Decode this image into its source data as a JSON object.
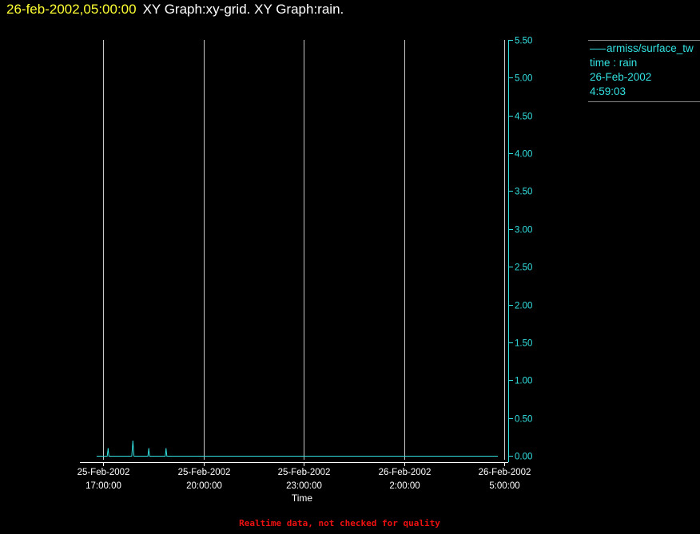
{
  "header": {
    "timestamp": "26-feb-2002,05:00:00",
    "graph_title": "XY Graph:xy-grid.  XY Graph:rain."
  },
  "legend": {
    "series_name": "armiss/surface_tw",
    "line2": "time : rain",
    "line3": "26-Feb-2002",
    "line4": "4:59:03"
  },
  "footer": {
    "note": "Realtime data, not checked for quality"
  },
  "colors": {
    "background": "#000000",
    "series": "#33e0e0",
    "grid": "#c8c8c8",
    "axis": "#ffffff",
    "timestamp": "#ffff33",
    "note": "#ee1111"
  },
  "chart_data": {
    "type": "line",
    "xlabel": "Time",
    "ylabel": "",
    "x_range": [
      "2002-02-25 16:48:00",
      "2002-02-26 04:48:00"
    ],
    "ylim": [
      0.0,
      5.5
    ],
    "y_ticks": [
      0.0,
      0.5,
      1.0,
      1.5,
      2.0,
      2.5,
      3.0,
      3.5,
      4.0,
      4.5,
      5.0,
      5.5
    ],
    "y_tick_labels": [
      "0.00",
      "0.50",
      "1.00",
      "1.50",
      "2.00",
      "2.50",
      "3.00",
      "3.50",
      "4.00",
      "4.50",
      "5.00",
      "5.50"
    ],
    "x_ticks": [
      {
        "time": "2002-02-25 17:00:00",
        "line1": "25-Feb-2002",
        "line2": "17:00:00"
      },
      {
        "time": "2002-02-25 20:00:00",
        "line1": "25-Feb-2002",
        "line2": "20:00:00"
      },
      {
        "time": "2002-02-25 23:00:00",
        "line1": "25-Feb-2002",
        "line2": "23:00:00"
      },
      {
        "time": "2002-02-26 02:00:00",
        "line1": "26-Feb-2002",
        "line2": "2:00:00"
      },
      {
        "time": "2002-02-26 05:00:00",
        "line1": "26-Feb-2002",
        "line2": "5:00:00"
      }
    ],
    "grid": "vertical",
    "y_axis_side": "right",
    "series": [
      {
        "name": "armiss/surface_tw",
        "points": [
          [
            "2002-02-25 16:48:00",
            0.0
          ],
          [
            "2002-02-25 17:07:00",
            0.0
          ],
          [
            "2002-02-25 17:08:30",
            0.1
          ],
          [
            "2002-02-25 17:10:00",
            0.0
          ],
          [
            "2002-02-25 17:51:00",
            0.0
          ],
          [
            "2002-02-25 17:53:00",
            0.2
          ],
          [
            "2002-02-25 17:55:00",
            0.0
          ],
          [
            "2002-02-25 18:20:00",
            0.0
          ],
          [
            "2002-02-25 18:21:30",
            0.1
          ],
          [
            "2002-02-25 18:23:00",
            0.0
          ],
          [
            "2002-02-25 18:51:00",
            0.0
          ],
          [
            "2002-02-25 18:52:30",
            0.1
          ],
          [
            "2002-02-25 18:54:00",
            0.0
          ],
          [
            "2002-02-26 04:48:00",
            0.0
          ]
        ]
      }
    ]
  }
}
